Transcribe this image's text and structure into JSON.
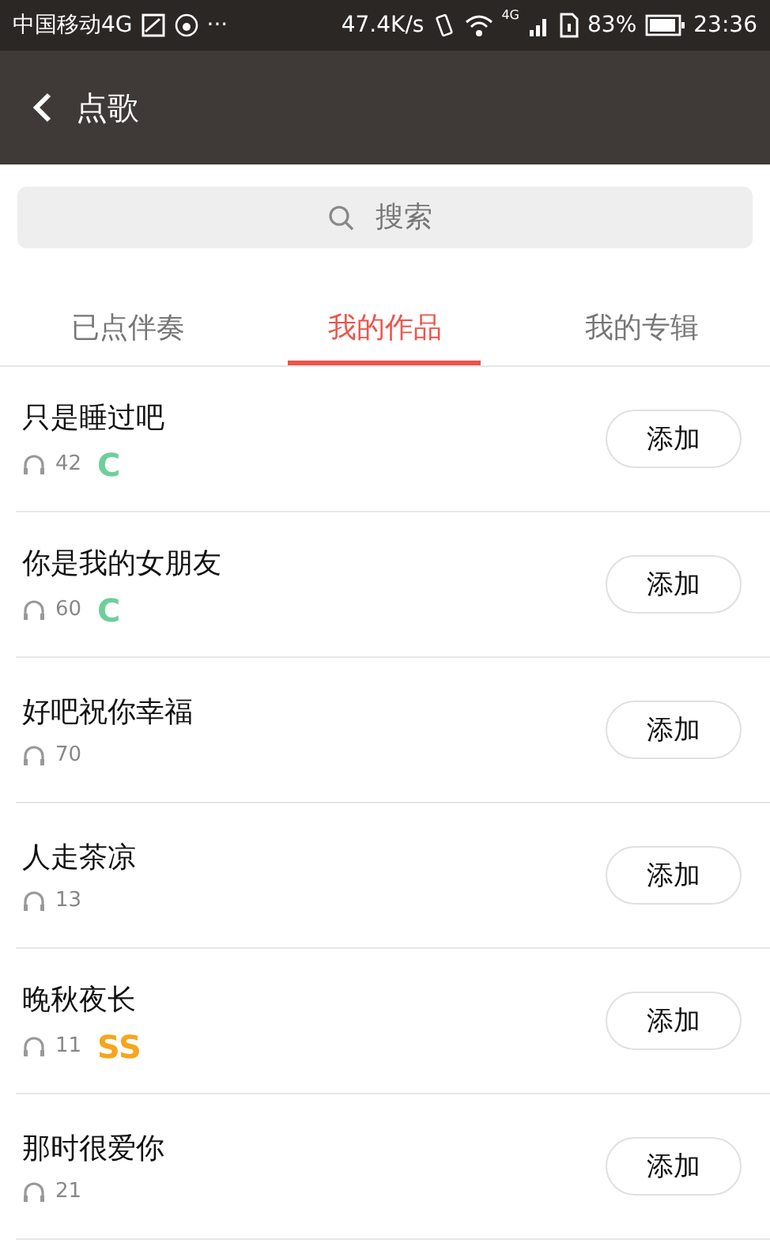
{
  "status_bar": {
    "carrier": "中国移动4G",
    "more": "···",
    "speed": "47.4K/s",
    "network": "4G",
    "battery": "83%",
    "time": "23:36"
  },
  "header": {
    "title": "点歌"
  },
  "search": {
    "placeholder": "搜索"
  },
  "tabs": [
    {
      "label": "已点伴奏",
      "selected": false
    },
    {
      "label": "我的作品",
      "selected": true
    },
    {
      "label": "我的专辑",
      "selected": false
    }
  ],
  "songs": [
    {
      "title": "只是睡过吧",
      "plays": "42",
      "grade": "C",
      "color": "#6ecf9a",
      "button": "添加"
    },
    {
      "title": "你是我的女朋友",
      "plays": "60",
      "grade": "C",
      "color": "#6ecf9a",
      "button": "添加"
    },
    {
      "title": "好吧祝你幸福",
      "plays": "70",
      "button": "添加"
    },
    {
      "title": "人走茶凉",
      "plays": "13",
      "button": "添加"
    },
    {
      "title": "晚秋夜长",
      "plays": "11",
      "grade": "SS",
      "color": "#f7a51c",
      "button": "添加"
    },
    {
      "title": "那时很爱你",
      "plays": "21",
      "button": "添加"
    }
  ]
}
